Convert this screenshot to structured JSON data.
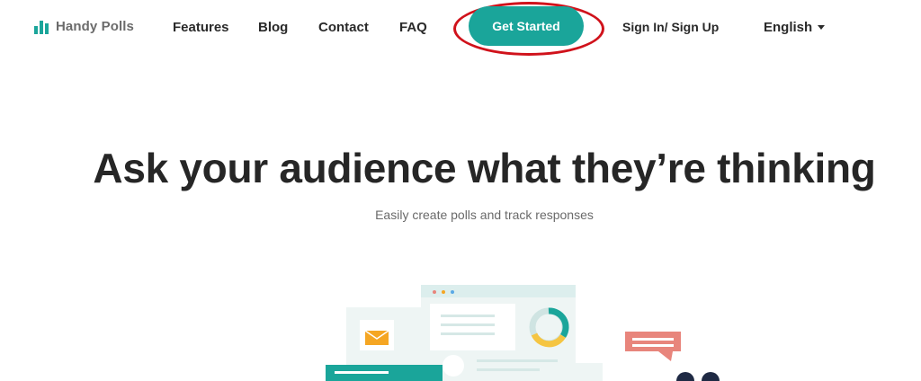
{
  "brand": {
    "name": "Handy Polls",
    "logo_color": "#1aa59a"
  },
  "nav": {
    "links": [
      "Features",
      "Blog",
      "Contact",
      "FAQ"
    ],
    "cta_label": "Get Started",
    "signin_label": "Sign In/ Sign Up",
    "language": "English"
  },
  "hero": {
    "title": "Ask your audience what they’re thinking",
    "subtitle": "Easily create polls and track responses"
  },
  "colors": {
    "accent": "#1aa59a",
    "highlight_ring": "#d0121b",
    "speech_bubble": "#e8857c"
  }
}
